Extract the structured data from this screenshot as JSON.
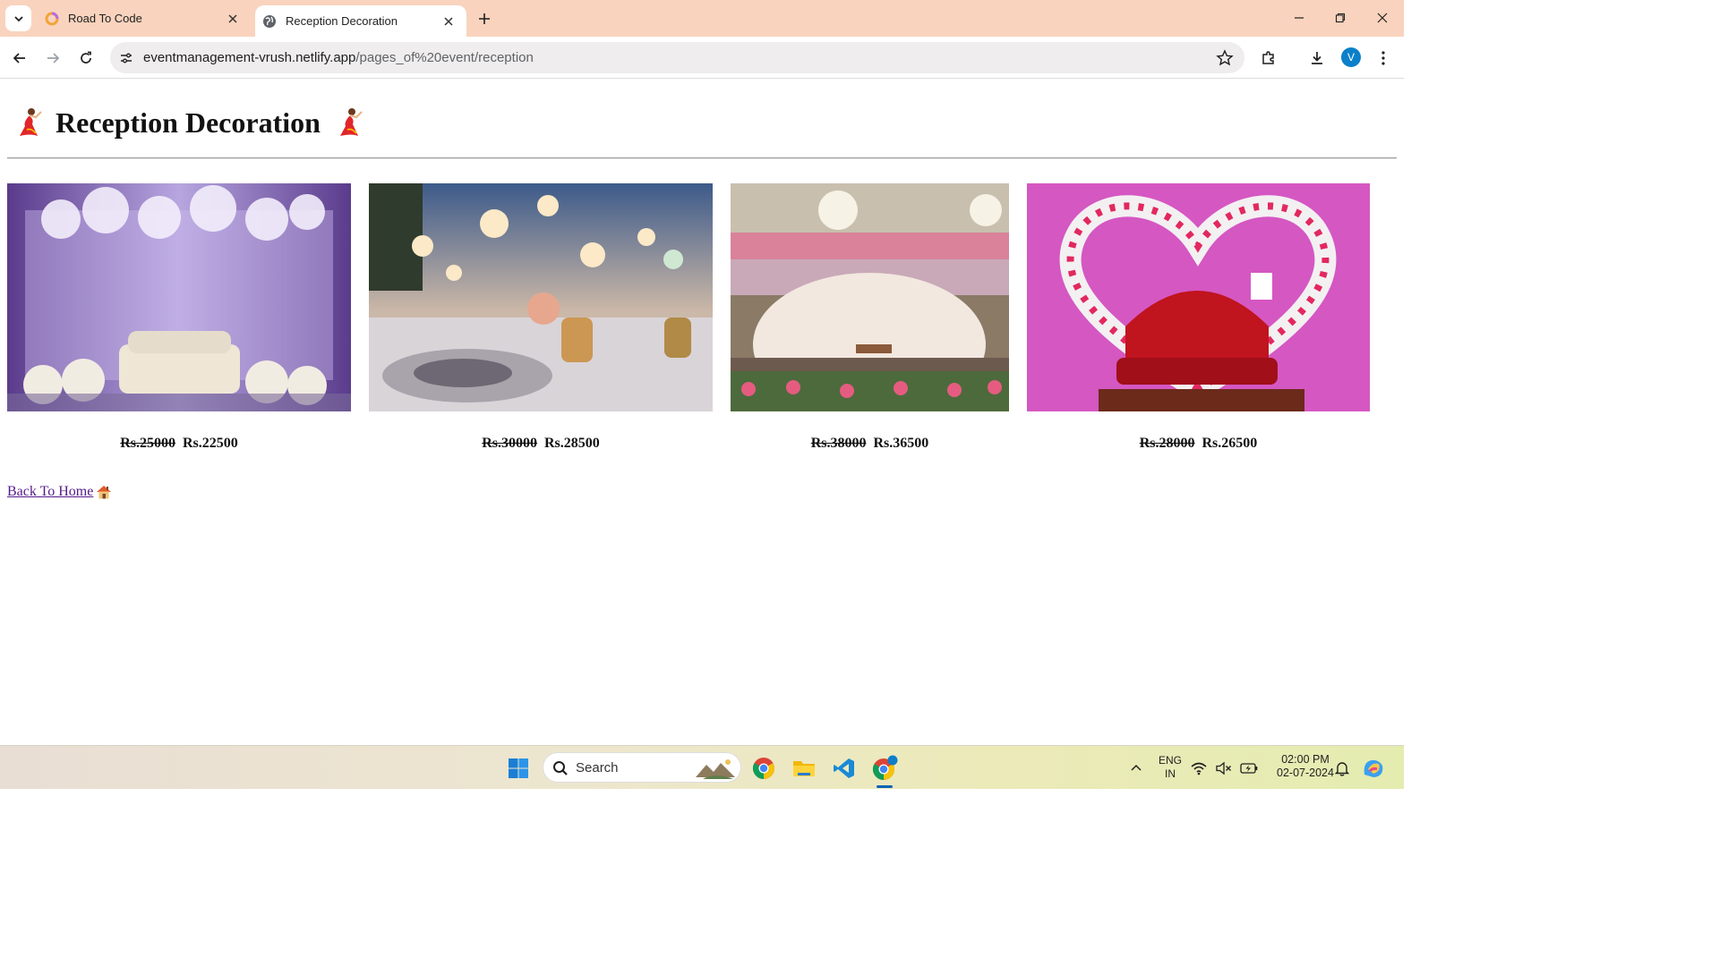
{
  "browser": {
    "tabs": [
      {
        "title": "Road To Code",
        "active": false,
        "icon": "rainbow-ring-icon"
      },
      {
        "title": "Reception Decoration",
        "active": true,
        "icon": "globe-icon"
      }
    ],
    "url_host": "eventmanagement-vrush.netlify.app",
    "url_path": "/pages_of%20event/reception",
    "profile_initial": "V"
  },
  "page": {
    "heading": "Reception Decoration",
    "heading_emoji": "dancer-icon",
    "products": [
      {
        "image": "purple-drape-floral-stage-photo",
        "old_price": "Rs.25000",
        "new_price": "Rs.22500"
      },
      {
        "image": "outdoor-lantern-dinner-table-photo",
        "old_price": "Rs.30000",
        "new_price": "Rs.28500"
      },
      {
        "image": "pink-floral-chandelier-stage-photo",
        "old_price": "Rs.38000",
        "new_price": "Rs.36500"
      },
      {
        "image": "heart-arch-red-sofa-stage-photo",
        "old_price": "Rs.28000",
        "new_price": "Rs.26500"
      }
    ],
    "back_link": "Back To Home",
    "back_link_icon": "house-icon"
  },
  "taskbar": {
    "search_label": "Search",
    "lang_line1": "ENG",
    "lang_line2": "IN",
    "time": "02:00 PM",
    "date": "02-07-2024"
  },
  "colors": {
    "tabstrip": "#f9d3bd",
    "link_visited": "#551a8b",
    "accent_blue": "#0b7fc9"
  }
}
